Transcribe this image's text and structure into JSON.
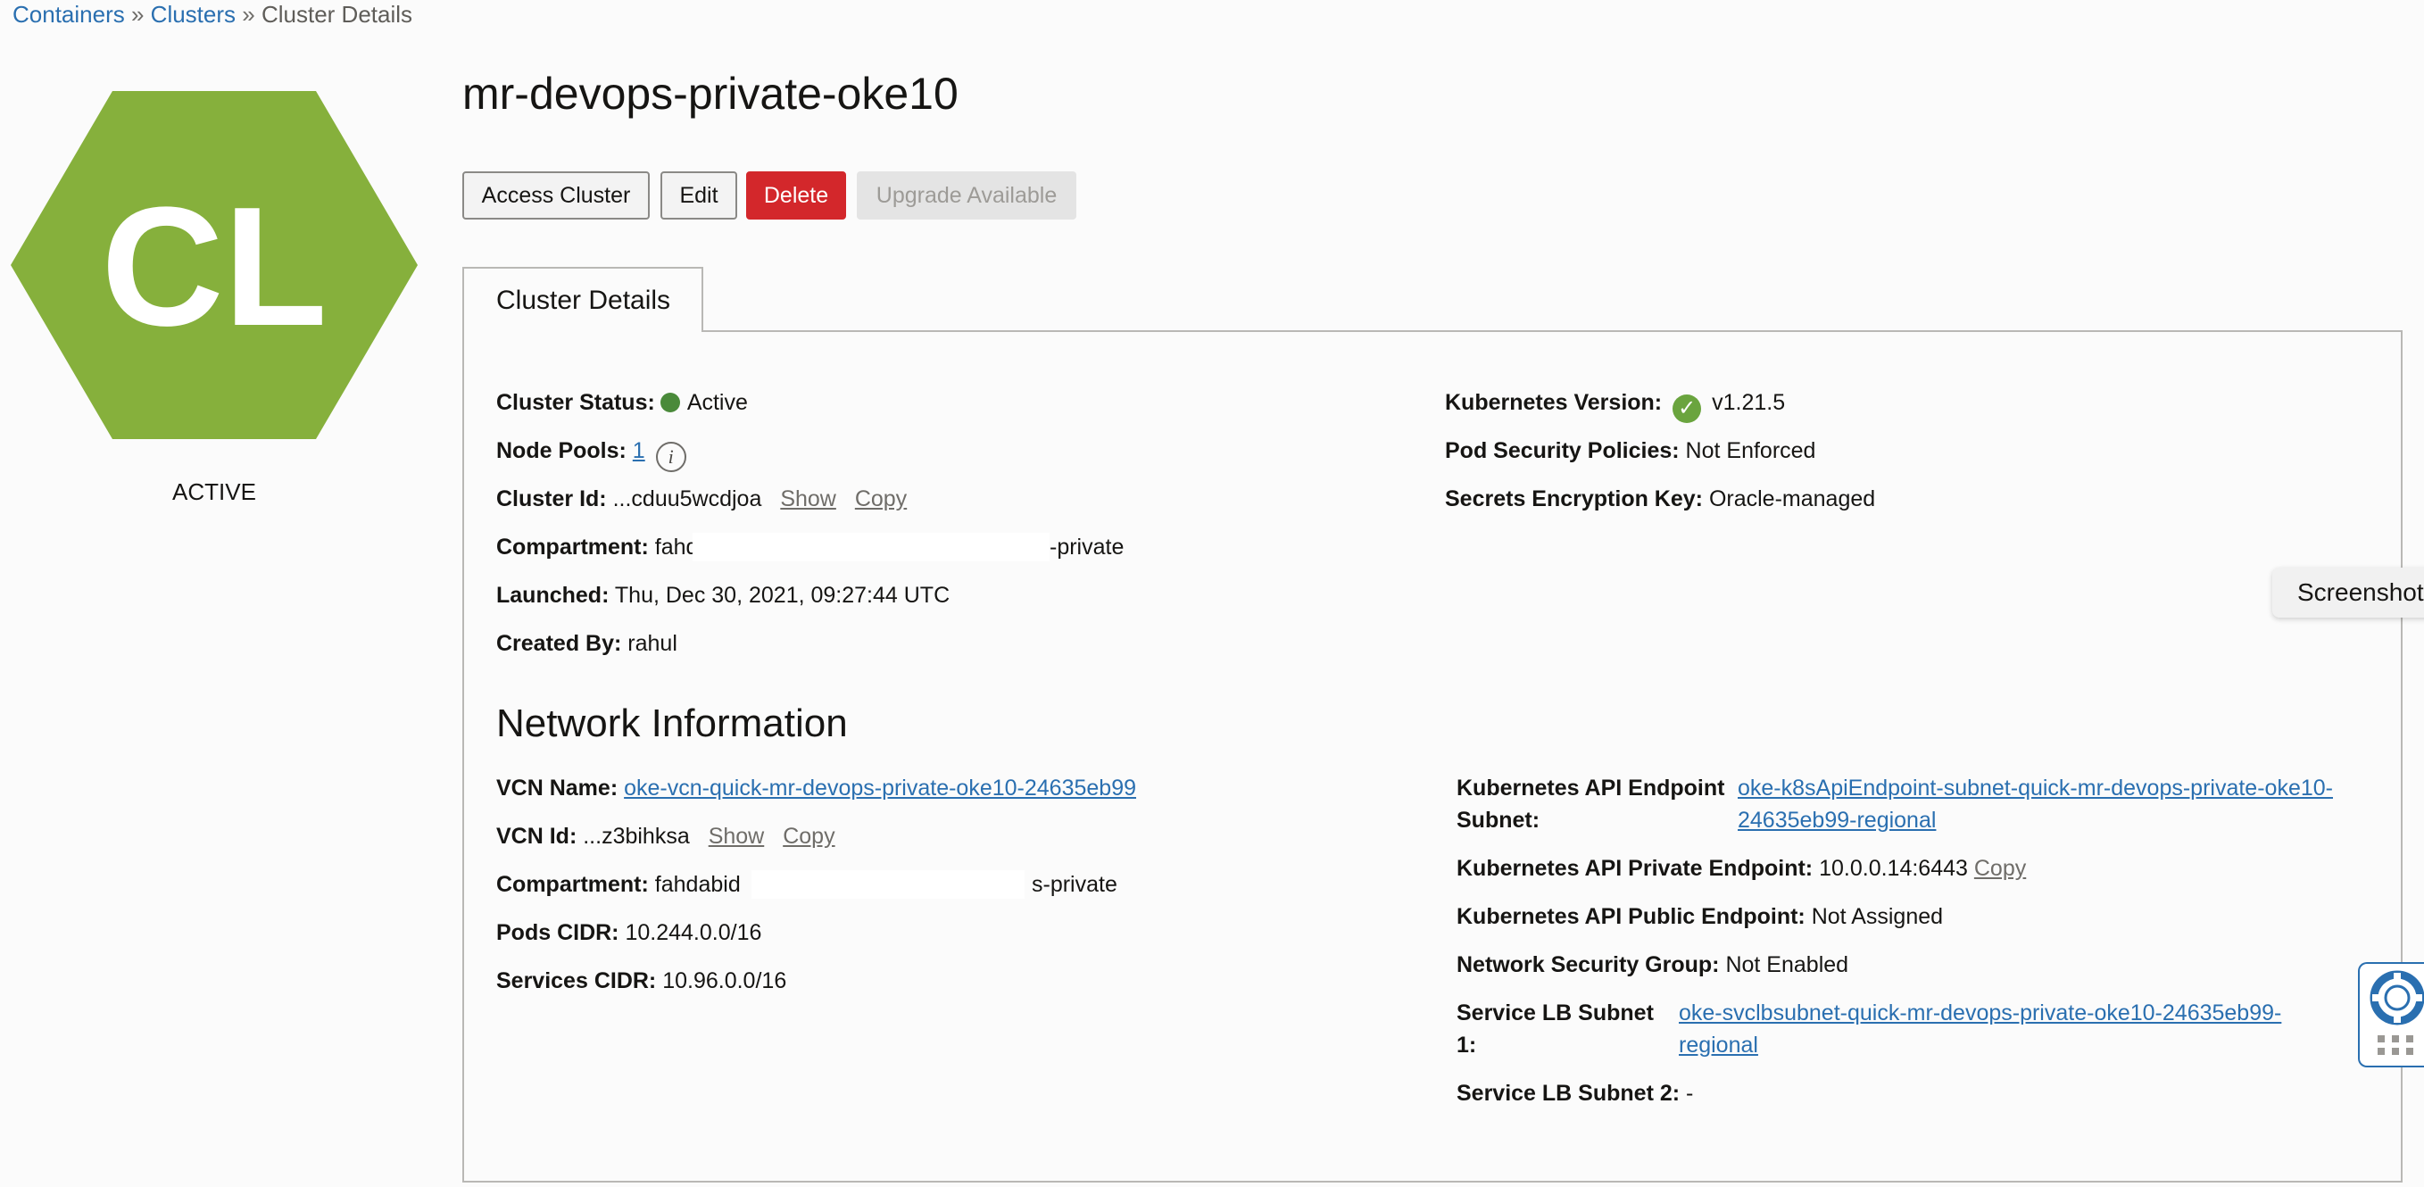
{
  "breadcrumb": {
    "items": [
      "Containers",
      "Clusters"
    ],
    "separator": "»",
    "current": "Cluster Details"
  },
  "cluster_icon": {
    "initials": "CL",
    "color": "#86b03c",
    "status": "ACTIVE"
  },
  "page_title": "mr-devops-private-oke10",
  "actions": {
    "access": "Access Cluster",
    "edit": "Edit",
    "delete": "Delete",
    "upgrade": "Upgrade Available"
  },
  "tab": "Cluster Details",
  "details": {
    "status_label": "Cluster Status:",
    "status_value": "Active",
    "node_pools_label": "Node Pools:",
    "node_pools_value": "1",
    "cluster_id_label": "Cluster Id:",
    "cluster_id_value": "...cduu5wcdjoa",
    "show": "Show",
    "copy": "Copy",
    "compartment_label": "Compartment:",
    "compartment_prefix": "fahda",
    "compartment_suffix": "-private",
    "launched_label": "Launched:",
    "launched_value": "Thu, Dec 30, 2021, 09:27:44 UTC",
    "created_by_label": "Created By:",
    "created_by_value": "rahul",
    "k8s_version_label": "Kubernetes Version:",
    "k8s_version_value": "v1.21.5",
    "psp_label": "Pod Security Policies:",
    "psp_value": "Not Enforced",
    "secrets_label": "Secrets Encryption Key:",
    "secrets_value": "Oracle-managed"
  },
  "network": {
    "heading": "Network Information",
    "vcn_name_label": "VCN Name:",
    "vcn_name_value": "oke-vcn-quick-mr-devops-private-oke10-24635eb99",
    "vcn_id_label": "VCN Id:",
    "vcn_id_value": "...z3bihksa",
    "show": "Show",
    "copy": "Copy",
    "compartment_label": "Compartment:",
    "compartment_prefix": "fahdabid",
    "compartment_suffix": "s-private",
    "pods_cidr_label": "Pods CIDR:",
    "pods_cidr_value": "10.244.0.0/16",
    "services_cidr_label": "Services CIDR:",
    "services_cidr_value": "10.96.0.0/16",
    "api_subnet_label_1": "Kubernetes API Endpoint",
    "api_subnet_label_2": "Subnet:",
    "api_subnet_value_1": "oke-k8sApiEndpoint-subnet-quick-mr-devops-private-oke10-",
    "api_subnet_value_2": "24635eb99-regional",
    "private_ep_label": "Kubernetes API Private Endpoint:",
    "private_ep_value": "10.0.0.14:6443",
    "private_ep_copy": "Copy",
    "public_ep_label": "Kubernetes API Public Endpoint:",
    "public_ep_value": "Not Assigned",
    "nsg_label": "Network Security Group:",
    "nsg_value": "Not Enabled",
    "lb1_label_1": "Service LB Subnet",
    "lb1_label_2": "1:",
    "lb1_value_1": "oke-svclbsubnet-quick-mr-devops-private-oke10-24635eb99-",
    "lb1_value_2": "regional",
    "lb2_label": "Service LB Subnet 2:",
    "lb2_value": "-"
  },
  "overlay": {
    "screenshot": "Screenshot"
  }
}
